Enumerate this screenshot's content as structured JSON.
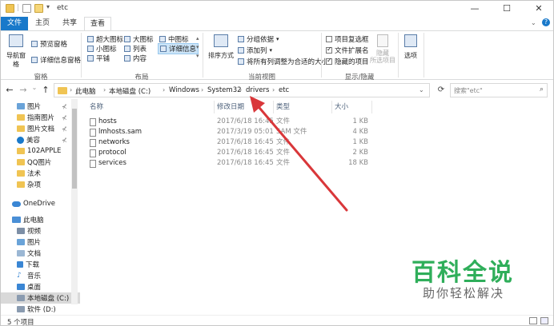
{
  "window": {
    "title": "etc",
    "minimize": "—",
    "maximize": "☐",
    "close": "✕"
  },
  "tabs": [
    {
      "label": "文件"
    },
    {
      "label": "主页"
    },
    {
      "label": "共享"
    },
    {
      "label": "查看"
    }
  ],
  "ribbon": {
    "panes": {
      "nav_pane": "导航窗格",
      "preview_pane": "预览窗格",
      "details_pane": "详细信息窗格",
      "label": "窗格"
    },
    "layout": {
      "items": [
        "超大图标",
        "大图标",
        "中图标",
        "小图标",
        "列表",
        "详细信息",
        "平铺",
        "内容"
      ],
      "label": "布局"
    },
    "current_view": {
      "sort": "排序方式",
      "group_by": "分组依据",
      "add_column": "添加列",
      "fit_columns": "将所有列调整为合适的大小",
      "label": "当前视图"
    },
    "show_hide": {
      "item_checkboxes": "项目复选框",
      "file_extensions": "文件扩展名",
      "hidden_items": "隐藏的项目",
      "hide_selected_1": "隐藏",
      "hide_selected_2": "所选项目",
      "label": "显示/隐藏"
    },
    "options": "选项"
  },
  "address": {
    "back": "←",
    "forward": "→",
    "recent": "⌄",
    "up": "↑",
    "crumbs": [
      "此电脑",
      "本地磁盘 (C:)",
      "Windows",
      "System32",
      "drivers",
      "etc"
    ],
    "refresh": "⟳",
    "search_placeholder": "搜索\"etc\"",
    "search_icon": "⌕"
  },
  "nav_pane": {
    "items": [
      {
        "label": "图片",
        "icon": "picture-icon",
        "pin": "📌"
      },
      {
        "label": "指南图片",
        "icon": "folder-icon",
        "pin": "📌"
      },
      {
        "label": "图片文档",
        "icon": "folder-icon",
        "pin": "📌"
      },
      {
        "label": "美容",
        "icon": "info-icon",
        "pin": "📌"
      },
      {
        "label": "102APPLE",
        "icon": "folder-icon"
      },
      {
        "label": "QQ图片",
        "icon": "folder-icon"
      },
      {
        "label": "法术",
        "icon": "folder-icon"
      },
      {
        "label": "杂项",
        "icon": "folder-icon"
      },
      {
        "label": "OneDrive",
        "icon": "cloud-icon"
      },
      {
        "label": "此电脑",
        "icon": "computer-icon"
      },
      {
        "label": "视频",
        "icon": "video-icon"
      },
      {
        "label": "图片",
        "icon": "picture-icon"
      },
      {
        "label": "文档",
        "icon": "document-icon"
      },
      {
        "label": "下载",
        "icon": "download-icon"
      },
      {
        "label": "音乐",
        "icon": "music-icon"
      },
      {
        "label": "桌面",
        "icon": "desktop-icon"
      },
      {
        "label": "本地磁盘 (C:)",
        "icon": "drive-icon"
      },
      {
        "label": "软件 (D:)",
        "icon": "drive-icon"
      }
    ]
  },
  "columns": [
    "名称",
    "修改日期",
    "类型",
    "大小"
  ],
  "files": [
    {
      "name": "hosts",
      "date": "2017/6/18 16:45",
      "type": "文件",
      "size": "1 KB"
    },
    {
      "name": "lmhosts.sam",
      "date": "2017/3/19 05:01",
      "type": "SAM 文件",
      "size": "4 KB"
    },
    {
      "name": "networks",
      "date": "2017/6/18 16:45",
      "type": "文件",
      "size": "1 KB"
    },
    {
      "name": "protocol",
      "date": "2017/6/18 16:45",
      "type": "文件",
      "size": "2 KB"
    },
    {
      "name": "services",
      "date": "2017/6/18 16:45",
      "type": "文件",
      "size": "18 KB"
    }
  ],
  "status": "5 个项目",
  "watermark": {
    "title": "百科全说",
    "subtitle": "助你轻松解决"
  },
  "colors": {
    "file_tab": "#1979ca",
    "arrow": "#d9373a",
    "watermark": "#2fae5a"
  }
}
